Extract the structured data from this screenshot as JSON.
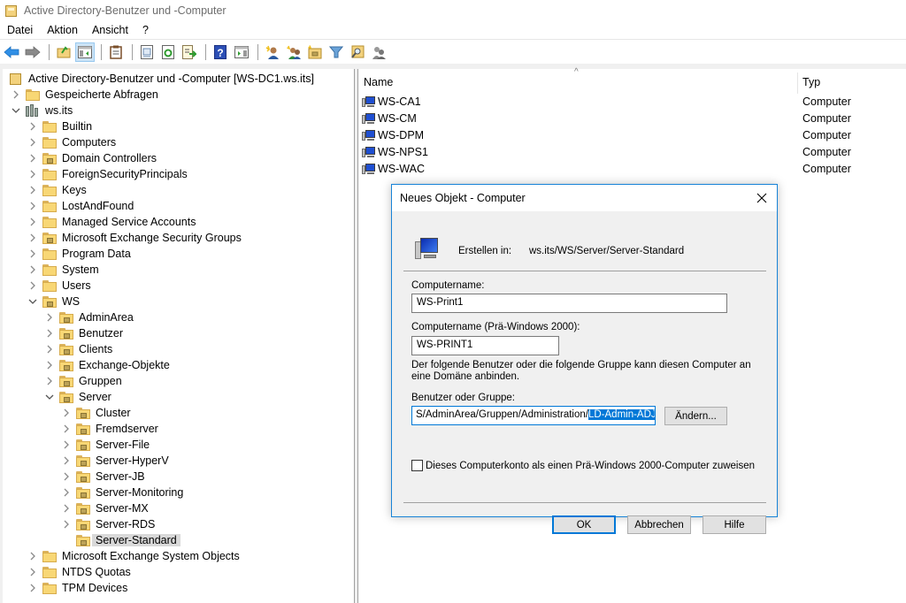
{
  "window": {
    "title": "Active Directory-Benutzer und -Computer"
  },
  "menu": [
    "Datei",
    "Aktion",
    "Ansicht",
    "?"
  ],
  "toolbar": {
    "buttons": [
      "back-arrow-icon",
      "forward-arrow-icon",
      "up-folder-icon",
      "show-hide-console-tree-icon",
      "clipboard-icon",
      "properties-icon",
      "refresh-icon",
      "export-list-icon",
      "help-icon",
      "show-action-pane-icon",
      "new-user-icon",
      "new-group-icon",
      "new-ou-icon",
      "filter-icon",
      "find-icon",
      "add-to-group-icon"
    ]
  },
  "tree": {
    "root": "Active Directory-Benutzer und -Computer [WS-DC1.ws.its]",
    "items": [
      {
        "label": "Gespeicherte Abfragen",
        "level": 1,
        "type": "folder",
        "expander": ">"
      },
      {
        "label": "ws.its",
        "level": 1,
        "type": "domain",
        "expander": "v"
      },
      {
        "label": "Builtin",
        "level": 2,
        "type": "folder",
        "expander": ">"
      },
      {
        "label": "Computers",
        "level": 2,
        "type": "folder",
        "expander": ">"
      },
      {
        "label": "Domain Controllers",
        "level": 2,
        "type": "ou",
        "expander": ">"
      },
      {
        "label": "ForeignSecurityPrincipals",
        "level": 2,
        "type": "folder",
        "expander": ">"
      },
      {
        "label": "Keys",
        "level": 2,
        "type": "folder",
        "expander": ">"
      },
      {
        "label": "LostAndFound",
        "level": 2,
        "type": "folder",
        "expander": ">"
      },
      {
        "label": "Managed Service Accounts",
        "level": 2,
        "type": "folder",
        "expander": ">"
      },
      {
        "label": "Microsoft Exchange Security Groups",
        "level": 2,
        "type": "ou",
        "expander": ">"
      },
      {
        "label": "Program Data",
        "level": 2,
        "type": "folder",
        "expander": ">"
      },
      {
        "label": "System",
        "level": 2,
        "type": "folder",
        "expander": ">"
      },
      {
        "label": "Users",
        "level": 2,
        "type": "folder",
        "expander": ">"
      },
      {
        "label": "WS",
        "level": 2,
        "type": "ou",
        "expander": "v"
      },
      {
        "label": "AdminArea",
        "level": 3,
        "type": "ou",
        "expander": ">"
      },
      {
        "label": "Benutzer",
        "level": 3,
        "type": "ou",
        "expander": ">"
      },
      {
        "label": "Clients",
        "level": 3,
        "type": "ou",
        "expander": ">"
      },
      {
        "label": "Exchange-Objekte",
        "level": 3,
        "type": "ou",
        "expander": ">"
      },
      {
        "label": "Gruppen",
        "level": 3,
        "type": "ou",
        "expander": ">"
      },
      {
        "label": "Server",
        "level": 3,
        "type": "ou",
        "expander": "v"
      },
      {
        "label": "Cluster",
        "level": 4,
        "type": "ou",
        "expander": ">"
      },
      {
        "label": "Fremdserver",
        "level": 4,
        "type": "ou",
        "expander": ">"
      },
      {
        "label": "Server-File",
        "level": 4,
        "type": "ou",
        "expander": ">"
      },
      {
        "label": "Server-HyperV",
        "level": 4,
        "type": "ou",
        "expander": ">"
      },
      {
        "label": "Server-JB",
        "level": 4,
        "type": "ou",
        "expander": ">"
      },
      {
        "label": "Server-Monitoring",
        "level": 4,
        "type": "ou",
        "expander": ">"
      },
      {
        "label": "Server-MX",
        "level": 4,
        "type": "ou",
        "expander": ">"
      },
      {
        "label": "Server-RDS",
        "level": 4,
        "type": "ou",
        "expander": ">"
      },
      {
        "label": "Server-Standard",
        "level": 4,
        "type": "ou",
        "expander": "",
        "selected": true
      },
      {
        "label": "Microsoft Exchange System Objects",
        "level": 2,
        "type": "folder",
        "expander": ">"
      },
      {
        "label": "NTDS Quotas",
        "level": 2,
        "type": "folder",
        "expander": ">"
      },
      {
        "label": "TPM Devices",
        "level": 2,
        "type": "folder",
        "expander": ">"
      }
    ]
  },
  "list": {
    "columns": {
      "name": "Name",
      "type": "Typ"
    },
    "rows": [
      {
        "name": "WS-CA1",
        "type": "Computer"
      },
      {
        "name": "WS-CM",
        "type": "Computer"
      },
      {
        "name": "WS-DPM",
        "type": "Computer"
      },
      {
        "name": "WS-NPS1",
        "type": "Computer"
      },
      {
        "name": "WS-WAC",
        "type": "Computer"
      }
    ]
  },
  "dialog": {
    "title": "Neues Objekt - Computer",
    "create_in_label": "Erstellen in:",
    "create_in_value": "ws.its/WS/Server/Server-Standard",
    "computername_label": "Computername:",
    "computername_value": "WS-Print1",
    "pre2000_label": "Computername (Prä-Windows 2000):",
    "pre2000_value": "WS-PRINT1",
    "info_text": "Der folgende Benutzer oder die folgende Gruppe kann diesen Computer an eine Domäne anbinden.",
    "user_group_label": "Benutzer oder Gruppe:",
    "user_group_value_prefix": "S/AdminArea/Gruppen/Administration/",
    "user_group_value_selected": "LD-Admin-ADJoin",
    "change_button": "Ändern...",
    "checkbox_label": "Dieses Computerkonto als einen Prä-Windows 2000-Computer zuweisen",
    "checkbox_checked": false,
    "ok_button": "OK",
    "cancel_button": "Abbrechen",
    "help_button": "Hilfe"
  }
}
